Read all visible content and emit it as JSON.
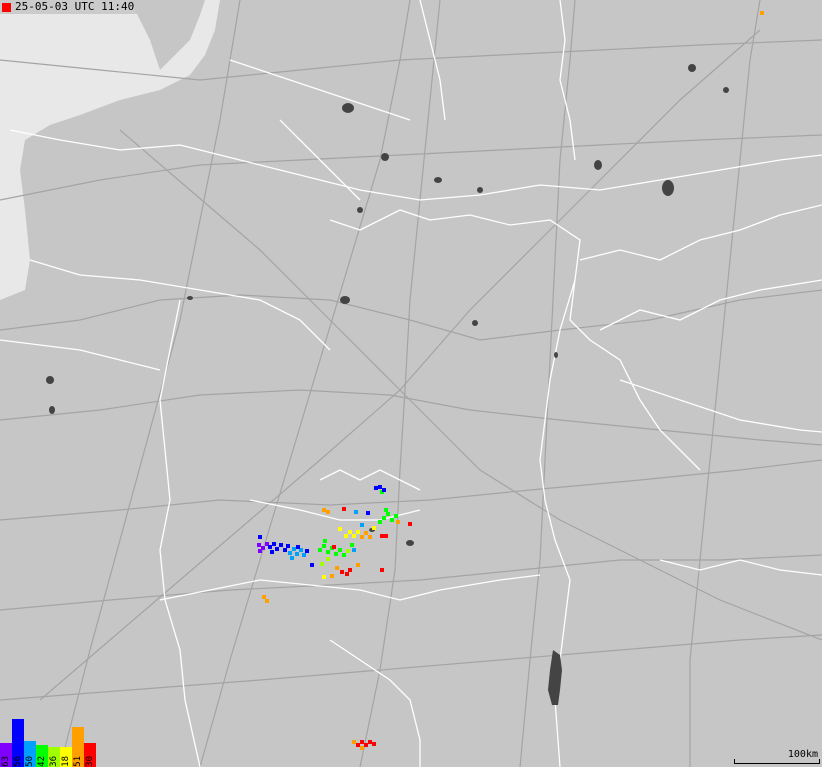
{
  "timestamp": "25-05-03 UTC 11:40",
  "legend": {
    "items": [
      {
        "label": "63",
        "color": "#8000ff"
      },
      {
        "label": "56",
        "color": "#0000ff"
      },
      {
        "label": "50",
        "color": "#00a0ff"
      },
      {
        "label": "42",
        "color": "#00ff00"
      },
      {
        "label": "36",
        "color": "#a0ff00"
      },
      {
        "label": "18",
        "color": "#ffff00"
      },
      {
        "label": "51",
        "color": "#ffa000"
      },
      {
        "label": "30",
        "color": "#ff0000"
      }
    ]
  },
  "scale": {
    "label": "100km"
  },
  "colors": {
    "land": "#c6c6c6",
    "sea": "#e8e8e8",
    "borders": "#ffffff",
    "roads": "#999999",
    "lakes": "#444444"
  }
}
